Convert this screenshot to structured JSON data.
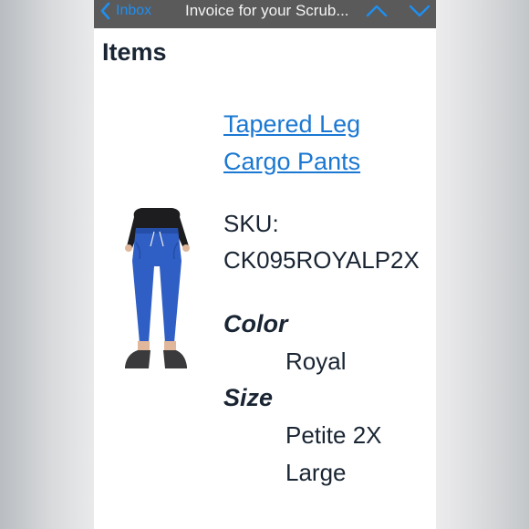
{
  "navbar": {
    "back_label": "Inbox",
    "title": "Invoice for your Scrub...",
    "accent": "#1f8ff0"
  },
  "items_section": {
    "title": "Items",
    "product": {
      "name_line1": "Tapered Leg",
      "name_line2": "Cargo Pants",
      "sku_label": "SKU:",
      "sku_value": "CK095ROYALP2X",
      "color_label": "Color",
      "color_value": "Royal",
      "size_label": "Size",
      "size_line1": "Petite 2X",
      "size_line2": "Large",
      "pants_color": "#2f5fc4"
    }
  }
}
